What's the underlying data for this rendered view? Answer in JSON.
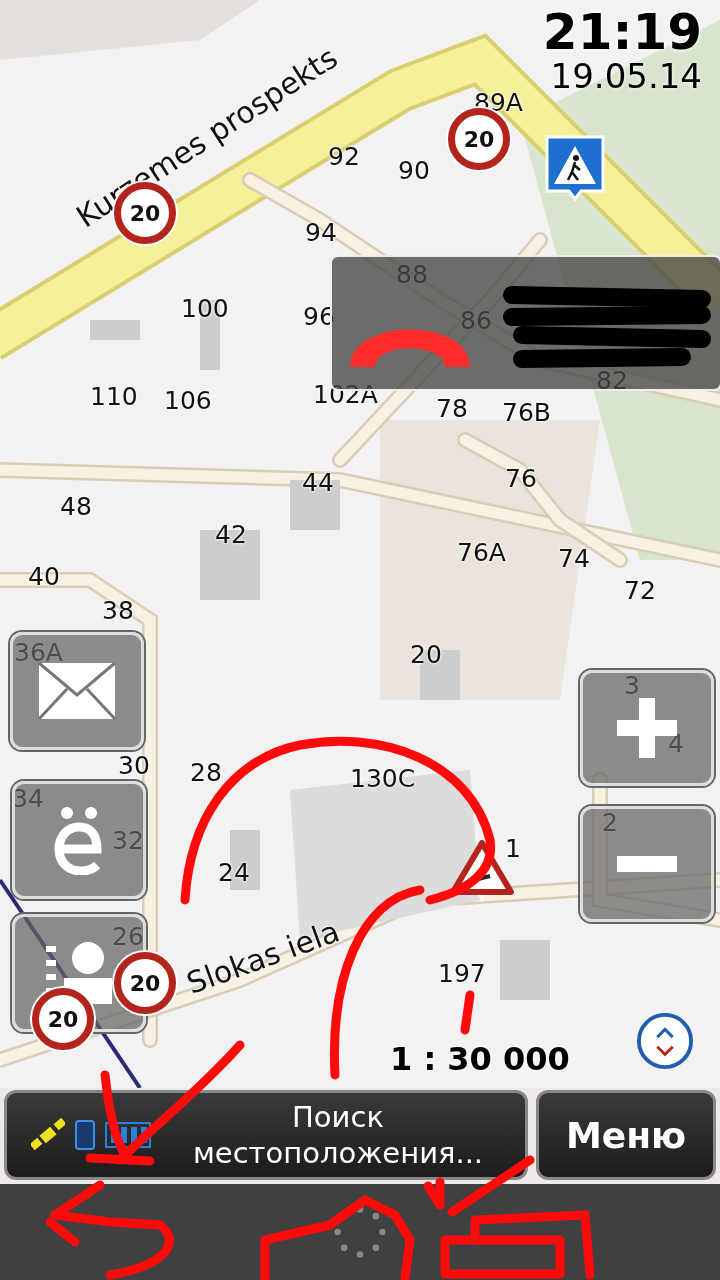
{
  "clock": {
    "time": "21:19",
    "date": "19.05.14"
  },
  "map": {
    "streets": [
      "Kurzemes prospekts",
      "Slokas iela"
    ],
    "house_numbers": [
      "89A",
      "92",
      "90",
      "94",
      "88",
      "100",
      "96",
      "86",
      "110",
      "106",
      "102A",
      "78",
      "76B",
      "82",
      "44",
      "76",
      "48",
      "42",
      "76A",
      "74",
      "72",
      "40",
      "38",
      "36A",
      "20",
      "3",
      "4",
      "30",
      "28",
      "130C",
      "2",
      "34",
      "32",
      "24",
      "1",
      "26",
      "197"
    ],
    "speed_limits": [
      "20",
      "20",
      "20",
      "20"
    ],
    "scale": "1 : 30 000"
  },
  "status": {
    "text": "Поиск местоположения...",
    "menu": "Меню"
  }
}
